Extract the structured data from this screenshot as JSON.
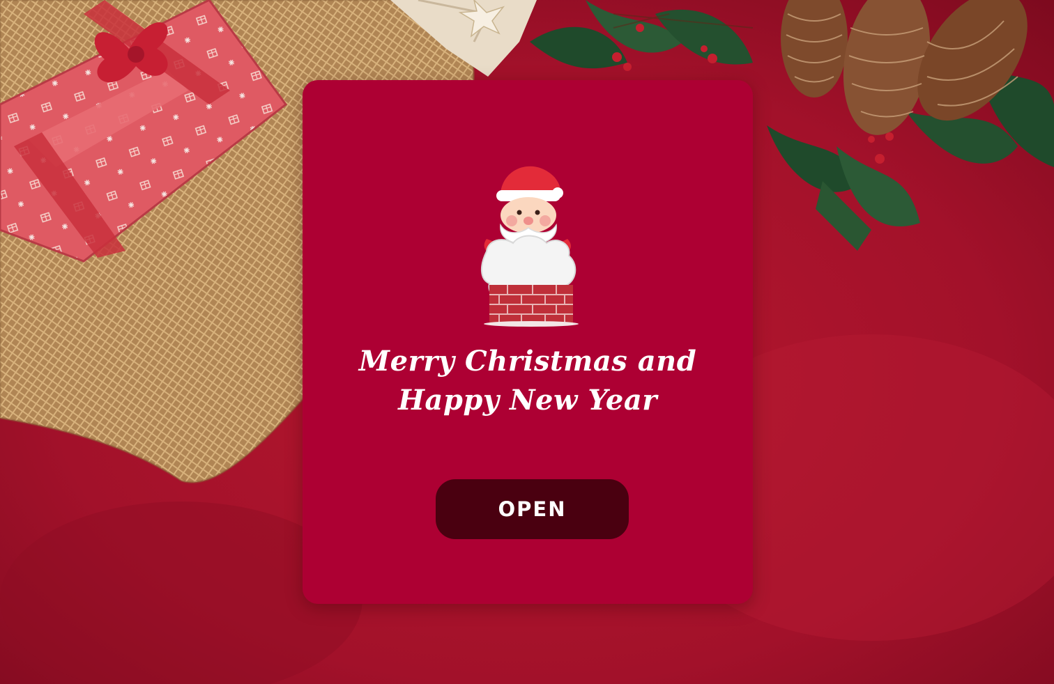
{
  "card": {
    "greeting_line_1": "Merry Christmas and",
    "greeting_line_2": "Happy New Year",
    "open_label": "OPEN"
  },
  "colors": {
    "card_background": "#ad0033",
    "button_background": "#4a0010",
    "text": "#ffffff",
    "velvet_background": "#a8122c"
  },
  "icons": {
    "santa": "santa-in-chimney-illustration",
    "gift": "gift-box-icon",
    "pine_cone": "pine-cone-icon",
    "holly": "holly-icon"
  }
}
